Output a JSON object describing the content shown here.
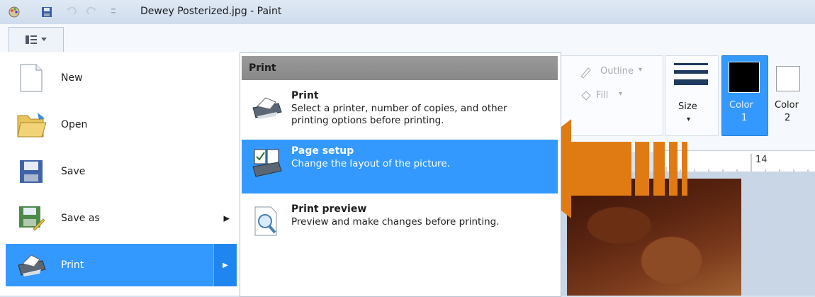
{
  "window": {
    "title": "Dewey Posterized.jpg - Paint"
  },
  "ribbon": {
    "outline_label": "Outline",
    "fill_label": "Fill",
    "size_label": "Size",
    "color1_label": "Color",
    "color1_num": "1",
    "color2_label": "Color",
    "color2_num": "2",
    "ruler_mark": "14",
    "color1_value": "#000000",
    "color2_value": "#ffffff"
  },
  "file_menu": {
    "items": [
      {
        "label": "New",
        "icon": "new-document-icon"
      },
      {
        "label": "Open",
        "icon": "folder-open-icon"
      },
      {
        "label": "Save",
        "icon": "floppy-disk-icon"
      },
      {
        "label": "Save as",
        "icon": "save-as-icon"
      },
      {
        "label": "Print",
        "icon": "printer-icon",
        "selected": true
      }
    ]
  },
  "print_submenu": {
    "header": "Print",
    "items": [
      {
        "title": "Print",
        "description": "Select a printer, number of copies, and other printing options before printing."
      },
      {
        "title": "Page setup",
        "description": "Change the layout of the picture.",
        "highlighted": true
      },
      {
        "title": "Print preview",
        "description": "Preview and make changes before printing."
      }
    ]
  },
  "accent_color": "#3399ff",
  "arrow_color": "#e07b14"
}
